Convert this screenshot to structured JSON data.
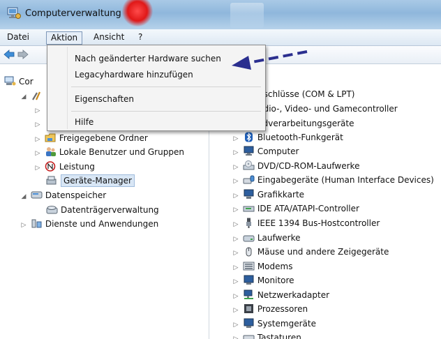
{
  "window": {
    "title": "Computerverwaltung"
  },
  "menubar": {
    "items": [
      "Datei",
      "Aktion",
      "Ansicht",
      "?"
    ]
  },
  "action_menu": {
    "items": [
      "Nach geänderter Hardware suchen",
      "Legacyhardware hinzufügen",
      "Eigenschaften",
      "Hilfe"
    ]
  },
  "left_tree": {
    "root_partial": "Cor",
    "shared_folders": "Freigegebene Ordner",
    "local_users": "Lokale Benutzer und Gruppen",
    "performance": "Leistung",
    "device_manager": "Geräte-Manager",
    "storage": "Datenspeicher",
    "disk_management": "Datenträgerverwaltung",
    "services_apps": "Dienste und Anwendungen"
  },
  "device_tree": {
    "items": [
      "nschlüsse (COM & LPT)",
      "udio-, Video- und Gamecontroller",
      "ildverarbeitungsgeräte",
      "Bluetooth-Funkgerät",
      "Computer",
      "DVD/CD-ROM-Laufwerke",
      "Eingabegeräte (Human Interface Devices)",
      "Grafikkarte",
      "IDE ATA/ATAPI-Controller",
      "IEEE 1394 Bus-Hostcontroller",
      "Laufwerke",
      "Mäuse und andere Zeigegeräte",
      "Modems",
      "Monitore",
      "Netzwerkadapter",
      "Prozessoren",
      "Systemgeräte",
      "Tastaturen"
    ]
  },
  "colors": {
    "accent_arrow": "#2b2f8f",
    "selection": "#d8e6f5"
  }
}
